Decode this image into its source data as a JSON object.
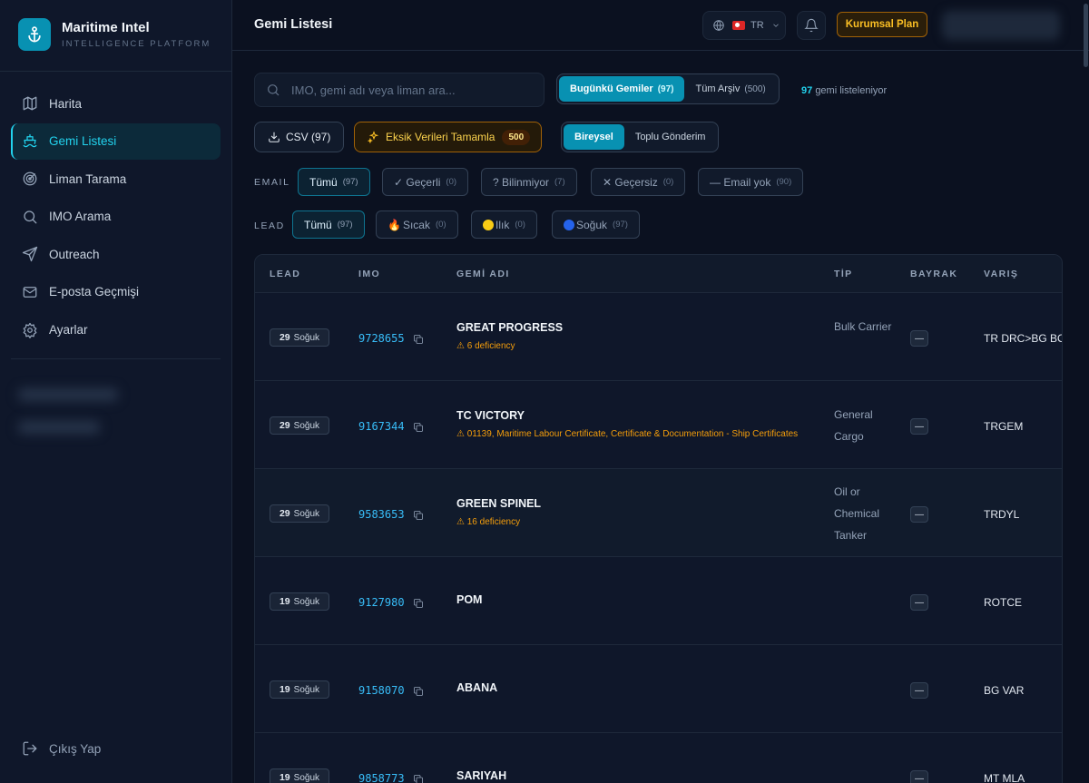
{
  "brand": {
    "title": "Maritime Intel",
    "subtitle": "INTELLIGENCE PLATFORM"
  },
  "nav": [
    {
      "label": "Harita",
      "icon": "map-icon",
      "active": false
    },
    {
      "label": "Gemi Listesi",
      "icon": "ship-icon",
      "active": true
    },
    {
      "label": "Liman Tarama",
      "icon": "radar-icon",
      "active": false
    },
    {
      "label": "IMO Arama",
      "icon": "search-icon",
      "active": false
    },
    {
      "label": "Outreach",
      "icon": "send-icon",
      "active": false
    },
    {
      "label": "E-posta Geçmişi",
      "icon": "mail-icon",
      "active": false
    },
    {
      "label": "Ayarlar",
      "icon": "gear-icon",
      "active": false
    }
  ],
  "logout_label": "Çıkış Yap",
  "header": {
    "title": "Gemi Listesi",
    "lang": "TR",
    "plan": "Kurumsal Plan"
  },
  "search": {
    "placeholder": "IMO, gemi adı veya liman ara..."
  },
  "scope_toggle": {
    "today": {
      "label": "Bugünkü Gemiler",
      "count": "(97)"
    },
    "archive": {
      "label": "Tüm Arşiv",
      "count": "(500)"
    }
  },
  "listing": {
    "count": "97",
    "text": "gemi listeleniyor"
  },
  "actions": {
    "csv": "CSV (97)",
    "fill": {
      "label": "Eksik Verileri Tamamla",
      "count": "500"
    },
    "individual": "Bireysel",
    "bulk": "Toplu Gönderim"
  },
  "email_filter": {
    "label": "EMAIL",
    "chips": [
      {
        "label": "Tümü",
        "count": "(97)",
        "active": true
      },
      {
        "label": "✓ Geçerli",
        "count": "(0)",
        "active": false
      },
      {
        "label": "? Bilinmiyor",
        "count": "(7)",
        "active": false
      },
      {
        "label": "✕ Geçersiz",
        "count": "(0)",
        "active": false
      },
      {
        "label": "— Email yok",
        "count": "(90)",
        "active": false
      }
    ]
  },
  "lead_filter": {
    "label": "LEAD",
    "chips": [
      {
        "label": "Tümü",
        "count": "(97)",
        "active": true
      },
      {
        "label": "Sıcak",
        "count": "(0)",
        "active": false
      },
      {
        "label": "Ilık",
        "count": "(0)",
        "active": false
      },
      {
        "label": "Soğuk",
        "count": "(97)",
        "active": false
      }
    ]
  },
  "table": {
    "headers": {
      "lead": "LEAD",
      "imo": "IMO",
      "name": "GEMİ ADI",
      "type": "TİP",
      "flag": "BAYRAK",
      "dest": "VARIŞ"
    },
    "rows": [
      {
        "score": "29",
        "lead": "Soğuk",
        "imo": "9728655",
        "name": "GREAT PROGRESS",
        "defic": "⚠ 6 deficiency",
        "type": "Bulk Carrier",
        "flag": "—",
        "dest": "TR DRC>BG BOJ"
      },
      {
        "score": "29",
        "lead": "Soğuk",
        "imo": "9167344",
        "name": "TC VICTORY",
        "defic": "⚠ 01139, Maritime Labour Certificate, Certificate & Documentation - Ship Certificates",
        "type": "General Cargo",
        "flag": "—",
        "dest": "TRGEM"
      },
      {
        "score": "29",
        "lead": "Soğuk",
        "imo": "9583653",
        "name": "GREEN SPINEL",
        "defic": "⚠ 16 deficiency",
        "type": "Oil or Chemical Tanker",
        "flag": "—",
        "dest": "TRDYL"
      },
      {
        "score": "19",
        "lead": "Soğuk",
        "imo": "9127980",
        "name": "POM",
        "defic": "",
        "type": "",
        "flag": "—",
        "dest": "ROTCE"
      },
      {
        "score": "19",
        "lead": "Soğuk",
        "imo": "9158070",
        "name": "ABANA",
        "defic": "",
        "type": "",
        "flag": "—",
        "dest": "BG VAR"
      },
      {
        "score": "19",
        "lead": "Soğuk",
        "imo": "9858773",
        "name": "SARIYAH",
        "defic": "",
        "type": "",
        "flag": "—",
        "dest": "MT MLA"
      }
    ]
  },
  "colors": {
    "accent": "#22d3ee",
    "accent_bg": "#0891b2",
    "warning": "#f59e0b",
    "bg": "#0b1120"
  }
}
